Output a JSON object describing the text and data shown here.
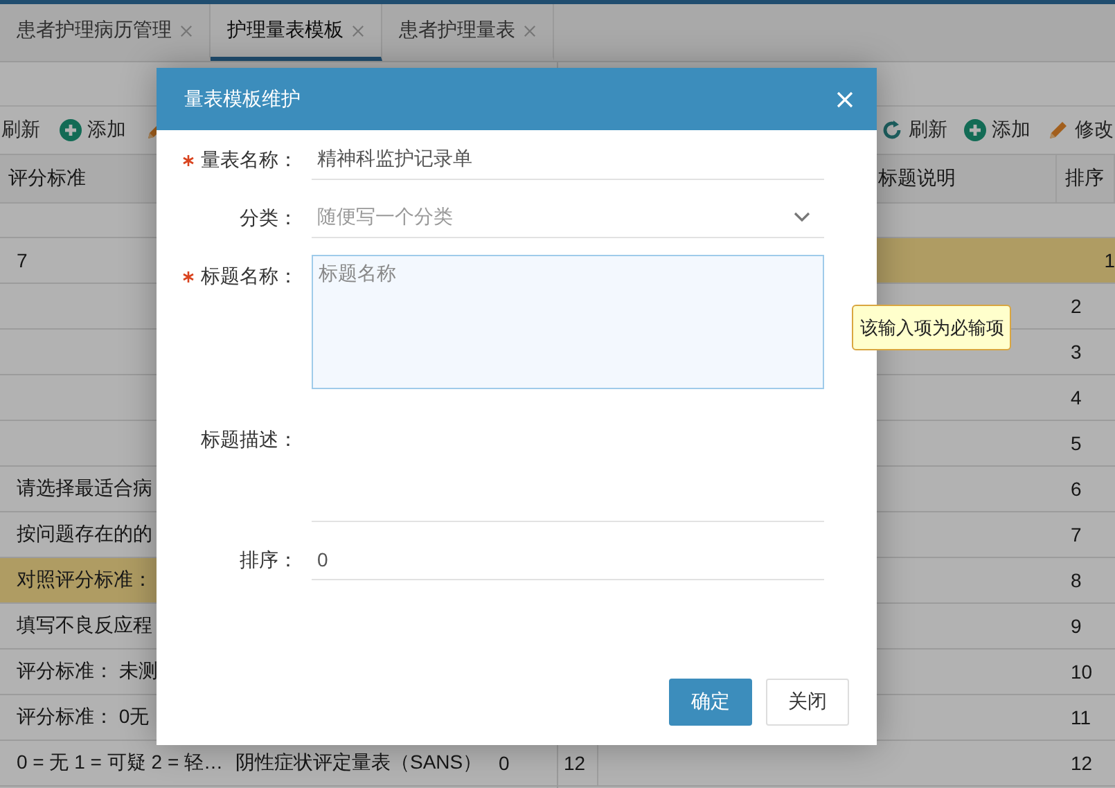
{
  "tabs": [
    {
      "label": "患者护理病历管理",
      "selected": false
    },
    {
      "label": "护理量表模板",
      "selected": true
    },
    {
      "label": "患者护理量表",
      "selected": false
    }
  ],
  "left_panel": {
    "toolbar": [
      {
        "kind": "text",
        "label": "刷新"
      },
      {
        "kind": "add",
        "label": "添加"
      },
      {
        "kind": "edit"
      }
    ],
    "columns": [
      "评分标准"
    ],
    "rows": [
      {
        "criteria": "7",
        "selected": false
      },
      {
        "selected": false
      },
      {
        "selected": false
      },
      {
        "selected": false
      },
      {
        "selected": false
      },
      {
        "criteria": "请选择最适合病",
        "selected": false
      },
      {
        "criteria": "按问题存在的的",
        "selected": false
      },
      {
        "criteria": "对照评分标准：",
        "selected": true
      },
      {
        "criteria": "填写不良反应程",
        "selected": false
      },
      {
        "criteria": "评分标准： 未测",
        "selected": false
      },
      {
        "criteria": "评分标准： 0无",
        "selected": false
      },
      {
        "criteria": "0 = 无 1 = 可疑 2 = 轻…",
        "name": "阴性症状评定量表（SANS）",
        "score": "0",
        "selected": false
      }
    ]
  },
  "right_panel": {
    "toolbar": [
      {
        "kind": "refresh",
        "label": "刷新"
      },
      {
        "kind": "add",
        "label": "添加"
      },
      {
        "kind": "edit",
        "label": "修改"
      }
    ],
    "columns": [
      "标题说明",
      "排序"
    ],
    "rows": [
      {
        "sort": "1",
        "selected": true
      },
      {
        "sort": "2",
        "selected": false
      },
      {
        "sort": "3",
        "selected": false
      },
      {
        "sort": "4",
        "selected": false
      },
      {
        "sort": "5",
        "selected": false
      },
      {
        "sort": "6",
        "selected": false
      },
      {
        "sort": "7",
        "selected": false
      },
      {
        "sort": "8",
        "selected": false
      },
      {
        "sort": "9",
        "selected": false
      },
      {
        "sort": "10",
        "selected": false
      },
      {
        "sort": "11",
        "selected": false
      },
      {
        "number": "12",
        "sort": "12",
        "selected": false
      }
    ]
  },
  "dialog": {
    "title": "量表模板维护",
    "fields": [
      {
        "kind": "text",
        "label": "量表名称：",
        "required": true,
        "value": "精神科监护记录单"
      },
      {
        "kind": "select",
        "label": "分类：",
        "required": false,
        "placeholder": "随便写一个分类"
      },
      {
        "kind": "textarea",
        "label": "标题名称：",
        "required": true,
        "placeholder": "标题名称",
        "invalid": true,
        "error": "该输入项为必输项"
      },
      {
        "kind": "plain",
        "label": "标题描述：",
        "required": false
      },
      {
        "kind": "text",
        "label": "排序：",
        "required": false,
        "value": "0"
      }
    ],
    "buttons": [
      {
        "label": "确定",
        "kind": "primary"
      },
      {
        "label": "关闭",
        "kind": "default"
      }
    ]
  }
}
